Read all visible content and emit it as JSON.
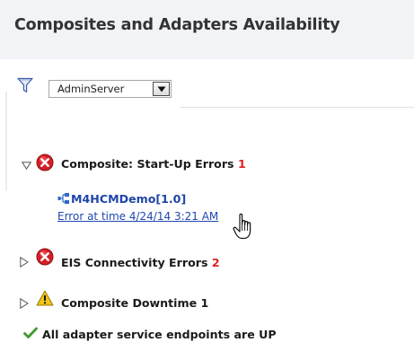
{
  "header": {
    "title": "Composites and Adapters Availability"
  },
  "filter": {
    "icon": "filter-icon",
    "server_select_value": "AdminServer",
    "dropdown_icon": "chevron-down-icon"
  },
  "sections": [
    {
      "expanded": true,
      "status_icon": "error-icon",
      "label": "Composite: Start-Up Errors",
      "count": "1",
      "count_color": "#e0201f",
      "composite": {
        "icon": "composite-icon",
        "name": "M4HCMDemo[1.0]"
      },
      "error_link": "Error at time 4/24/14 3:21 AM"
    },
    {
      "expanded": false,
      "status_icon": "error-icon",
      "label": "EIS Connectivity Errors",
      "count": "2",
      "count_color": "#e0201f"
    },
    {
      "expanded": false,
      "status_icon": "warning-icon",
      "label": "Composite Downtime",
      "count": "1",
      "count_color": "#1b1b1b"
    }
  ],
  "status_message": {
    "icon": "checkmark-icon",
    "text": "All adapter service endpoints are UP"
  },
  "colors": {
    "error": "#d41f26",
    "warning": "#f0c419",
    "ok": "#3f9a2e",
    "link": "#1f47b0"
  }
}
